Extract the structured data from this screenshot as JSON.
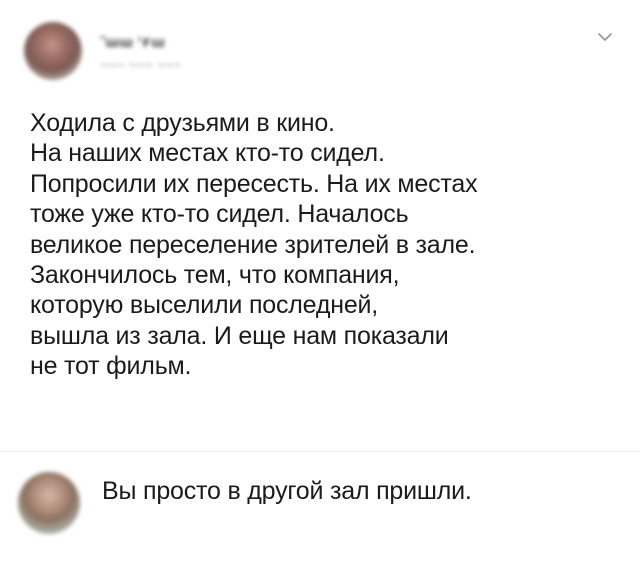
{
  "tweet": {
    "author_name": "˜ɯɯ ʻꜰɯ",
    "author_handle": "~~~ ~~~ ~~~",
    "text_lines": [
      "Ходила с друзьями в кино.",
      "На наших местах кто-то сидел.",
      "Попросили их пересесть. На их местах",
      "тоже уже кто-то сидел. Началось",
      "великое переселение зрителей в зале.",
      "Закончилось тем, что компания,",
      "которую выселили последней,",
      "вышла из зала. И еще нам показали",
      "не тот фильм."
    ],
    "menu_icon": "chevron-down-icon"
  },
  "reply": {
    "text": "Вы просто в другой зал пришли."
  },
  "colors": {
    "text": "#1b1b1b",
    "chevron": "#8899a6",
    "divider": "#e6ecf0"
  }
}
